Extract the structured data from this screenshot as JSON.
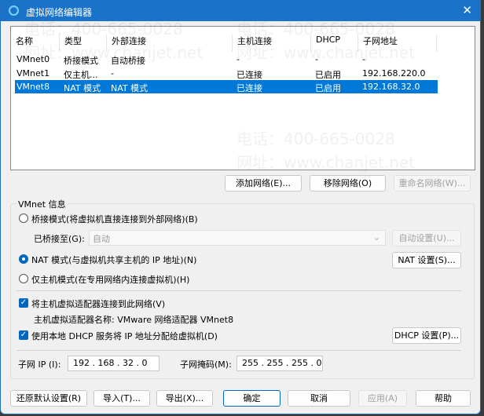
{
  "window": {
    "title": "虚拟网络编辑器",
    "close": "✕"
  },
  "table": {
    "headers": [
      "名称",
      "类型",
      "外部连接",
      "主机连接",
      "DHCP",
      "子网地址"
    ],
    "rows": [
      [
        "VMnet0",
        "桥接模式",
        "自动桥接",
        "-",
        "-",
        "-"
      ],
      [
        "VMnet1",
        "仅主机...",
        "-",
        "已连接",
        "已启用",
        "192.168.220.0"
      ],
      [
        "VMnet8",
        "NAT 模式",
        "NAT 模式",
        "已连接",
        "已启用",
        "192.168.32.0"
      ]
    ],
    "selected_index": 2
  },
  "list_buttons": {
    "add": "添加网络(E)...",
    "remove": "移除网络(O)",
    "rename": "重命名网络(W)..."
  },
  "info": {
    "group_label": "VMnet 信息",
    "bridged_label": "桥接模式(将虚拟机直接连接到外部网络)(B)",
    "bridged_to_label": "已桥接至(G):",
    "bridged_to_value": "自动",
    "auto_settings": "自动设置(U)...",
    "nat_label": "NAT 模式(与虚拟机共享主机的 IP 地址)(N)",
    "nat_settings": "NAT 设置(S)...",
    "hostonly_label": "仅主机模式(在专用网络内连接虚拟机)(H)",
    "selected_mode": "nat",
    "connect_adapter_label": "将主机虚拟适配器连接到此网络(V)",
    "connect_adapter_checked": true,
    "adapter_name": "主机虚拟适配器名称: VMware 网络适配器 VMnet8",
    "dhcp_label": "使用本地 DHCP 服务将 IP 地址分配给虚拟机(D)",
    "dhcp_checked": true,
    "dhcp_settings": "DHCP 设置(P)...",
    "subnet_ip_label": "子网 IP (I):",
    "subnet_ip": "192 . 168 . 32 . 0",
    "subnet_mask_label": "子网掩码(M):",
    "subnet_mask": "255 . 255 . 255 . 0"
  },
  "footer": {
    "restore": "还原默认设置(R)",
    "import": "导入(T)...",
    "export": "导出(X)...",
    "ok": "确定",
    "cancel": "取消",
    "apply": "应用(A)",
    "help": "帮助"
  },
  "watermark": {
    "phone": "电话：400-665-0028",
    "site": "网址：www.chanjet.net"
  }
}
